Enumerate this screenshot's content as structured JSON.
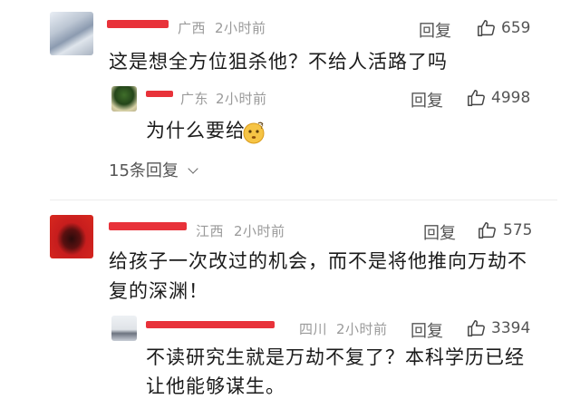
{
  "comments": [
    {
      "region": "广西",
      "time": "2小时前",
      "text": "这是想全方位狙杀他？不给人活路了吗",
      "reply_label": "回复",
      "likes": "659",
      "reply": {
        "region": "广东",
        "time": "2小时前",
        "text": "为什么要给",
        "emoji": "emoji-face-icon",
        "reply_label": "回复",
        "likes": "4998"
      },
      "more_replies": "15条回复"
    },
    {
      "region": "江西",
      "time": "2小时前",
      "text_line1": "给孩子一次改过的机会，而不是将他推向万劫不",
      "text_line2": "复的深渊！",
      "reply_label": "回复",
      "likes": "575",
      "reply": {
        "region": "四川",
        "time": "2小时前",
        "text_line1": "不读研究生就是万劫不复了？本科学历已经",
        "text_line2": "让他能够谋生。",
        "reply_label": "回复",
        "likes": "3394"
      }
    }
  ],
  "colors": {
    "name_redaction": "#e8323a",
    "meta": "#9a9a9a",
    "text": "#1b1b1b"
  }
}
